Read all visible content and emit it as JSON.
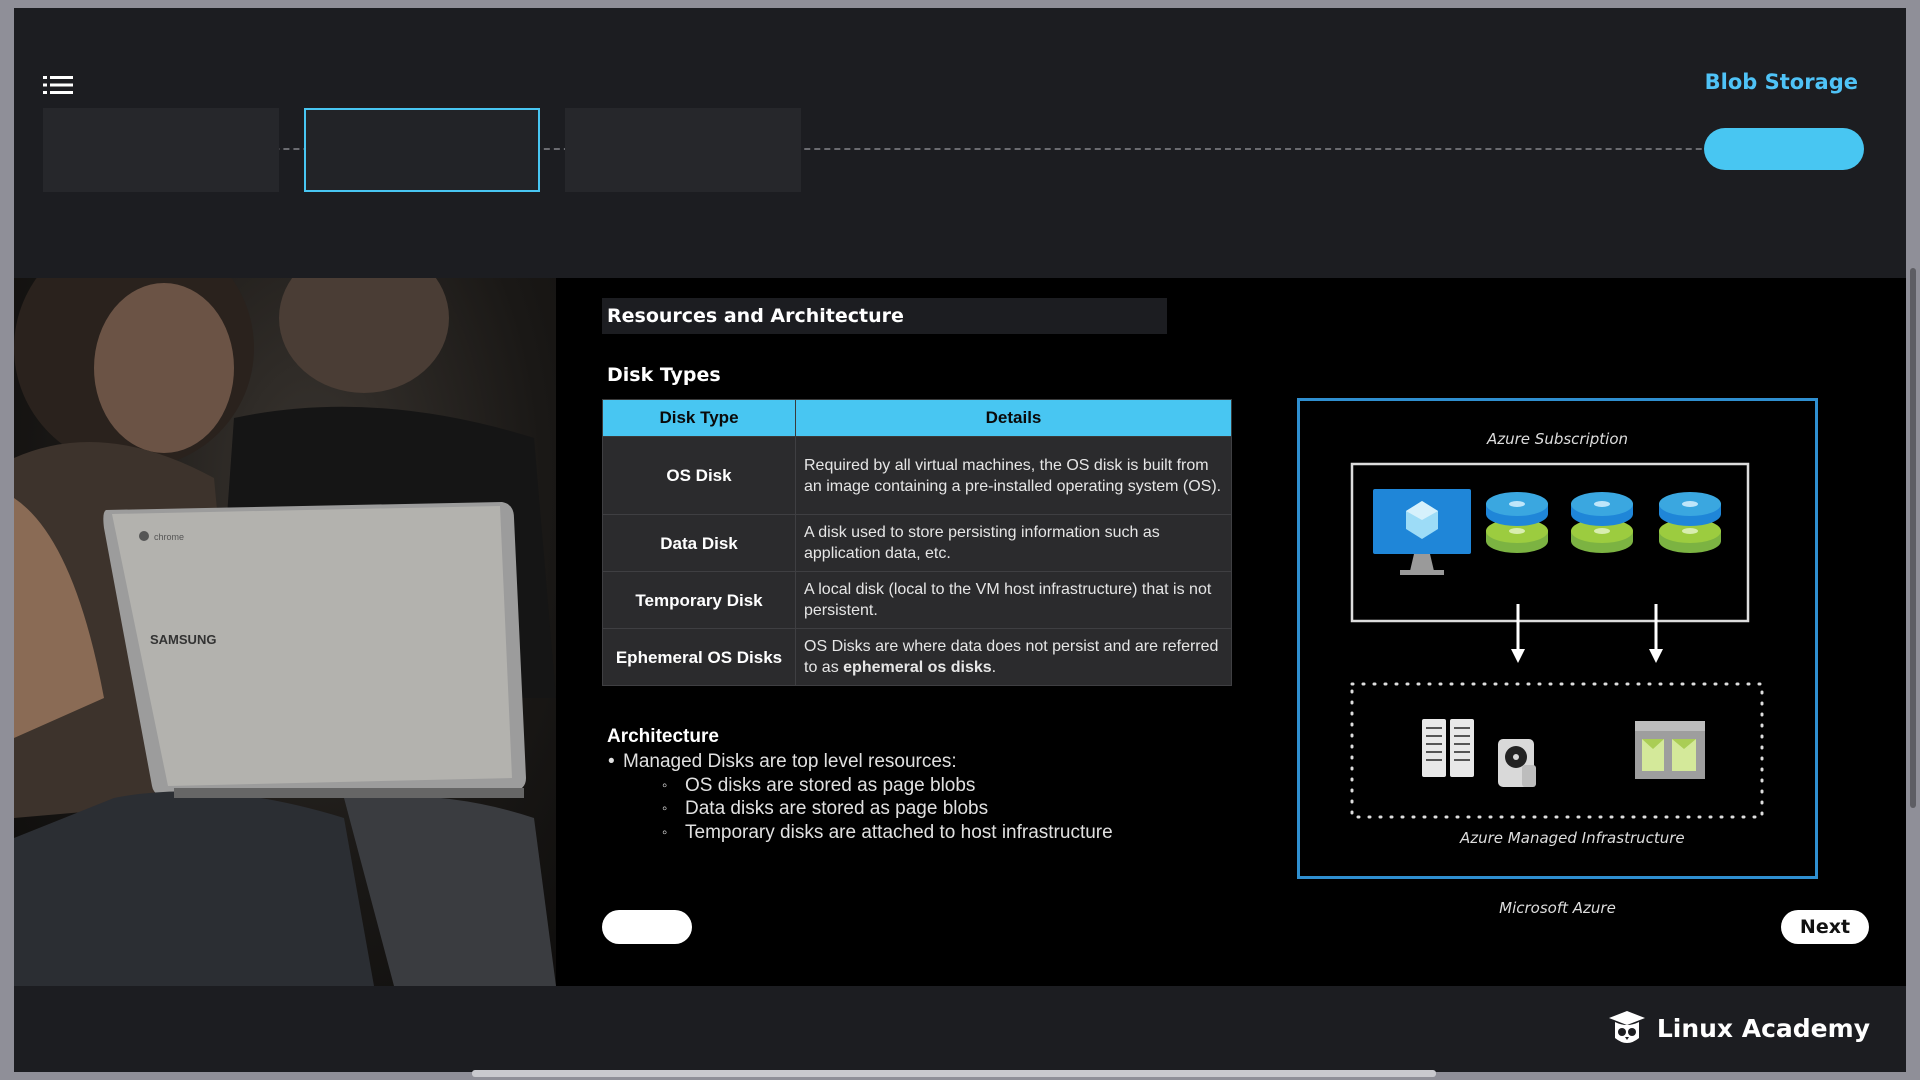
{
  "header": {
    "course_title": "Blob Storage",
    "menu_icon": "list-menu-icon"
  },
  "slide": {
    "heading": "Resources and Architecture",
    "subheading": "Disk Types",
    "table": {
      "columns": [
        "Disk Type",
        "Details"
      ],
      "rows": [
        {
          "name": "OS Disk",
          "details": "Required by all virtual machines, the OS disk is built from an image containing a pre-installed operating system (OS)."
        },
        {
          "name": "Data Disk",
          "details": "A disk used to store persisting information such as application data, etc."
        },
        {
          "name": "Temporary Disk",
          "details": "A local disk (local to the VM host infrastructure) that is not persistent."
        },
        {
          "name": "Ephemeral OS Disks",
          "details_prefix": "OS Disks are where data does not persist and are referred to as ",
          "details_bold": "ephemeral os disks",
          "details_suffix": "."
        }
      ]
    },
    "architecture_title": "Architecture",
    "architecture_bullet": "Managed Disks are top level resources:",
    "architecture_sub_bullets": [
      "OS disks are stored as page blobs",
      "Data disks are stored as page blobs",
      "Temporary disks are attached to host infrastructure"
    ],
    "next_label": "Next"
  },
  "diagram": {
    "subscription_label": "Azure Subscription",
    "managed_label": "Azure Managed Infrastructure",
    "caption": "Microsoft Azure",
    "colors": {
      "border": "#2f8fd0",
      "monitor": "#1f86d8",
      "disk_top": "#3aa7e0",
      "disk_bottom": "#8dc63f"
    }
  },
  "footer": {
    "brand": "Linux Academy"
  },
  "photo": {
    "laptop_brand": "SAMSUNG",
    "laptop_logo": "chrome"
  },
  "colors": {
    "accent": "#48c6f2",
    "background": "#1c1d21"
  }
}
